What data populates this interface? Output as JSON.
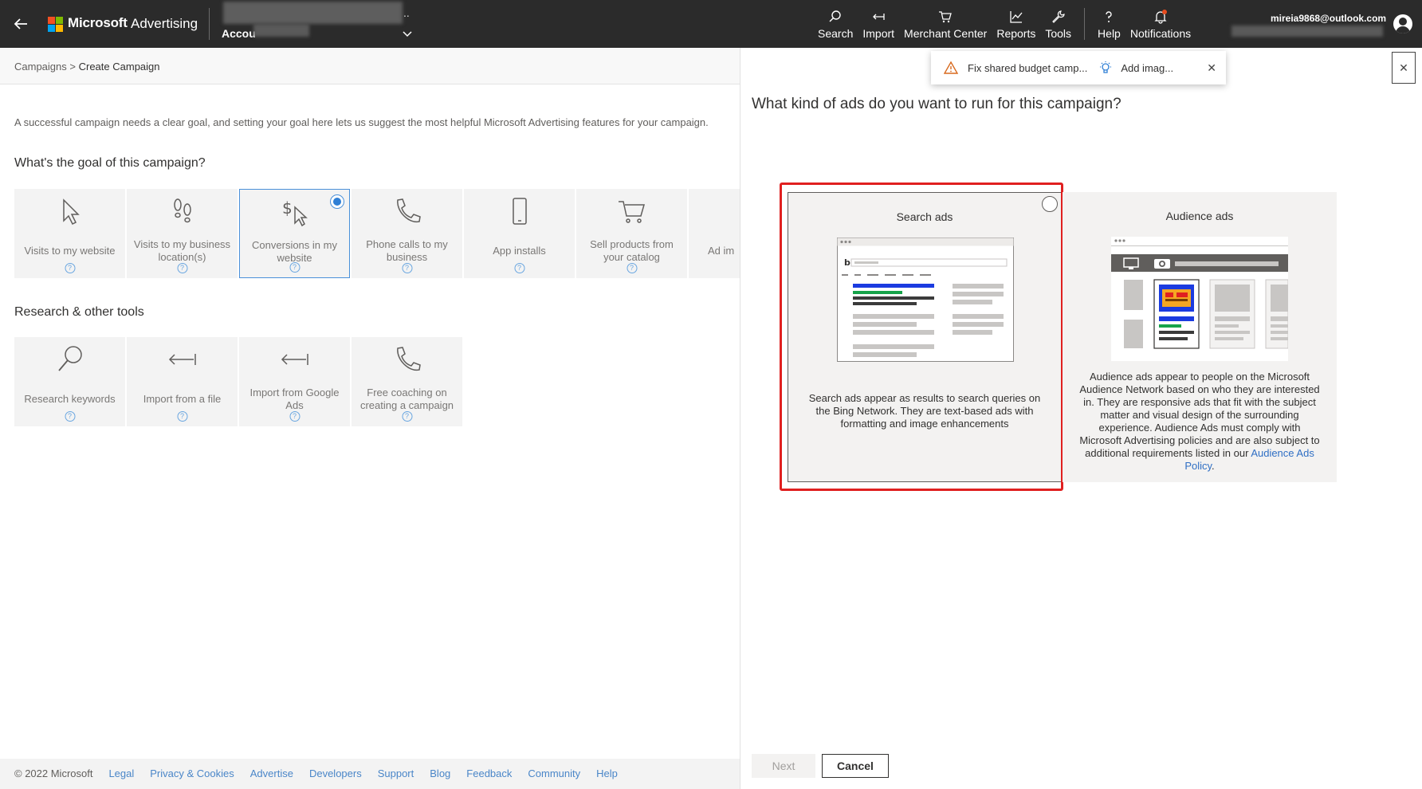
{
  "header": {
    "brand_name": "Microsoft",
    "product_name": "Advertising",
    "account_label": "Accou",
    "account_dots": "..",
    "user_email": "mireia9868@outlook.com",
    "nav": [
      {
        "label": "Search",
        "icon": "search-icon"
      },
      {
        "label": "Import",
        "icon": "import-icon"
      },
      {
        "label": "Merchant Center",
        "icon": "cart-icon"
      },
      {
        "label": "Reports",
        "icon": "chart-icon"
      },
      {
        "label": "Tools",
        "icon": "wrench-icon"
      },
      {
        "label": "Help",
        "icon": "question-icon"
      },
      {
        "label": "Notifications",
        "icon": "bell-icon"
      }
    ],
    "logo_colors": [
      "#f25022",
      "#7fba00",
      "#00a4ef",
      "#ffb900"
    ]
  },
  "breadcrumb": {
    "parent": "Campaigns",
    "separator": ">",
    "current": "Create Campaign"
  },
  "intro": "A successful campaign needs a clear goal, and setting your goal here lets us suggest the most helpful Microsoft Advertising features for your campaign.",
  "goals": {
    "title": "What's the goal of this campaign?",
    "tiles": [
      {
        "label": "Visits to my website",
        "icon": "cursor-icon",
        "selected": false
      },
      {
        "label": "Visits to my business location(s)",
        "icon": "footsteps-icon",
        "selected": false
      },
      {
        "label": "Conversions in my website",
        "icon": "dollar-cursor-icon",
        "selected": true
      },
      {
        "label": "Phone calls to my business",
        "icon": "phone-icon",
        "selected": false
      },
      {
        "label": "App installs",
        "icon": "mobile-icon",
        "selected": false
      },
      {
        "label": "Sell products from your catalog",
        "icon": "cart-icon",
        "selected": false
      },
      {
        "label": "Ad im",
        "icon": "image-icon",
        "selected": false
      }
    ]
  },
  "research": {
    "title": "Research & other tools",
    "tiles": [
      {
        "label": "Research keywords",
        "icon": "magnifier-icon"
      },
      {
        "label": "Import from a file",
        "icon": "import-arrow-icon"
      },
      {
        "label": "Import from Google Ads",
        "icon": "import-arrow-icon"
      },
      {
        "label": "Free coaching on creating a campaign",
        "icon": "phone-icon"
      }
    ]
  },
  "help_glyph": "?",
  "footer": {
    "copyright": "© 2022 Microsoft",
    "links": [
      "Legal",
      "Privacy & Cookies",
      "Advertise",
      "Developers",
      "Support",
      "Blog",
      "Feedback",
      "Community",
      "Help"
    ]
  },
  "toast": {
    "warning_text": "Fix shared budget camp...",
    "tip_text": "Add imag...",
    "close_glyph": "✕"
  },
  "panel": {
    "close_glyph": "✕",
    "title": "What kind of ads do you want to run for this campaign?",
    "cards": {
      "search": {
        "title": "Search ads",
        "description": "Search ads appear as results to search queries on the Bing Network. They are text-based ads with formatting and image enhancements"
      },
      "audience": {
        "title": "Audience ads",
        "description": "Audience ads appear to people on the Microsoft Audience Network based on who they are interested in. They are responsive ads that fit with the subject matter and visual design of the surrounding experience. Audience Ads must comply with Microsoft Advertising policies and are also subject to additional requirements listed in our",
        "link_text": "Audience Ads Policy",
        "trailing": "."
      }
    },
    "buttons": {
      "next": "Next",
      "cancel": "Cancel"
    }
  },
  "colors": {
    "topbar": "#2b2b2b",
    "accent_blue": "#2f7fd5",
    "highlight_red": "#e02020",
    "link_blue": "#4a86c8"
  }
}
